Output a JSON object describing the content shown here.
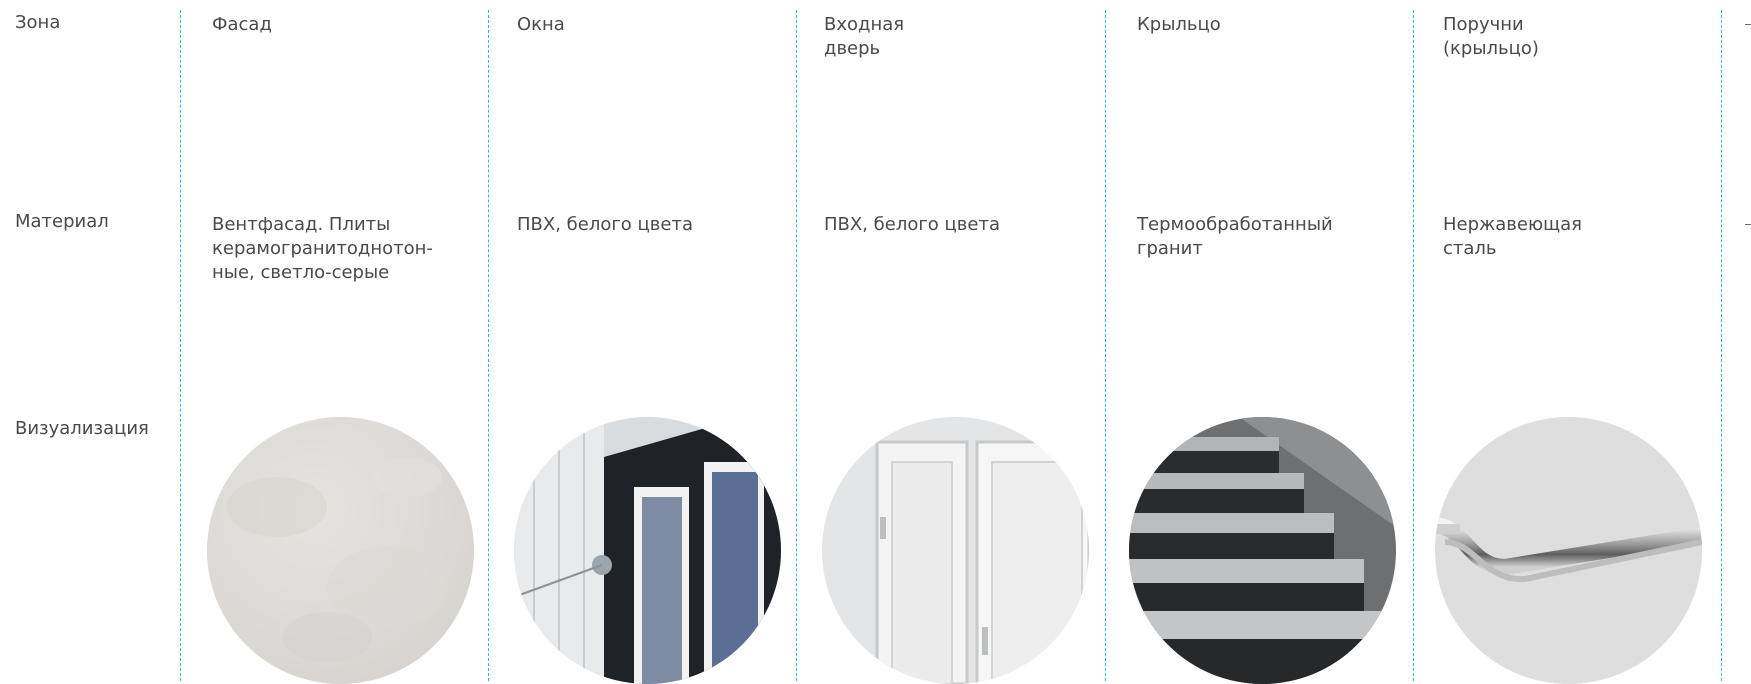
{
  "rows": {
    "zone_label": "Зона",
    "material_label": "Материал",
    "visual_label": "Визуализация"
  },
  "columns": [
    {
      "zone": "Фасад",
      "material": "Вентфасад. Плиты\nкерамогранитоднотон-\nные, светло-серые",
      "visual_icon": "light-grey-porcelain-tile"
    },
    {
      "zone": "Окна",
      "material": "ПВХ, белого цвета",
      "visual_icon": "pvc-window-photo"
    },
    {
      "zone": "Входная\nдверь",
      "material": "ПВХ, белого цвета",
      "visual_icon": "white-pvc-door-photo"
    },
    {
      "zone": "Крыльцо",
      "material": "Термообработанный\nгранит",
      "visual_icon": "granite-steps-photo"
    },
    {
      "zone": "Поручни\n(крыльцо)",
      "material": "Нержавеющая\nсталь",
      "visual_icon": "stainless-steel-handrail-photo"
    }
  ],
  "colors": {
    "divider": "#35b6d8",
    "text": "#4a4a4a"
  }
}
